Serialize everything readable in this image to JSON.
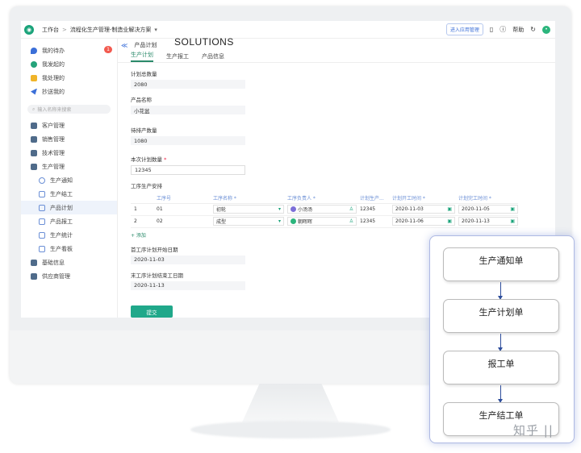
{
  "overlay_heading": "SOLUTIONS",
  "topbar": {
    "workbench": "工作台",
    "app_title": "流程化生产管理-制造业解决方案",
    "enter_app_mgmt": "进入应用管理",
    "help": "帮助"
  },
  "sidebar": {
    "items": [
      {
        "label": "我的待办",
        "badge": "1"
      },
      {
        "label": "我发起的"
      },
      {
        "label": "我处理的"
      },
      {
        "label": "抄送我的"
      }
    ],
    "search_placeholder": "输入名称来搜索",
    "groups": [
      {
        "label": "客户管理"
      },
      {
        "label": "销售管理"
      },
      {
        "label": "技术管理"
      },
      {
        "label": "生产管理"
      }
    ],
    "sub_items": [
      {
        "label": "生产通知"
      },
      {
        "label": "生产结工"
      },
      {
        "label": "产品计划"
      },
      {
        "label": "产品报工"
      },
      {
        "label": "生产统计"
      },
      {
        "label": "生产看板"
      }
    ],
    "bottom_groups": [
      {
        "label": "基础信息"
      },
      {
        "label": "供应商管理"
      }
    ]
  },
  "main": {
    "page_title": "产品计划",
    "tabs": [
      "生产计划",
      "生产报工",
      "产品信息"
    ],
    "fields": {
      "total_plan_label": "计划总数量",
      "total_plan_value": "2080",
      "product_name_label": "产品名称",
      "product_name_value": "小花盆",
      "to_produce_label": "待排产数量",
      "to_produce_value": "1080",
      "this_plan_label": "本次计划数量",
      "this_plan_value": "12345",
      "process_label": "工序生产安排",
      "first_start_label": "首工序计划开始日期",
      "first_start_value": "2020-11-03",
      "last_end_label": "末工序计划结束工日期",
      "last_end_value": "2020-11-13"
    },
    "table": {
      "headers": [
        "工序号",
        "工序名称 *",
        "工序负责人 *",
        "计划生产...",
        "计划开工时间 *",
        "计划完工时间 *"
      ],
      "rows": [
        {
          "idx": "1",
          "no": "01",
          "name": "初轮",
          "owner": "小汤汤",
          "qty": "12345",
          "start": "2020-11-03",
          "end": "2020-11-05"
        },
        {
          "idx": "2",
          "no": "02",
          "name": "成型",
          "owner": "朝晖晖",
          "qty": "12345",
          "start": "2020-11-06",
          "end": "2020-11-13"
        }
      ],
      "add_label": "+ 添加"
    },
    "submit_label": "提交"
  },
  "flow": {
    "steps": [
      "生产通知单",
      "生产计划单",
      "报工单",
      "生产结工单"
    ]
  },
  "watermark": "知乎 ||",
  "colors": {
    "accent": "#20a88a",
    "flow_border": "#aeb9e3",
    "arrow": "#2d4d9b"
  }
}
